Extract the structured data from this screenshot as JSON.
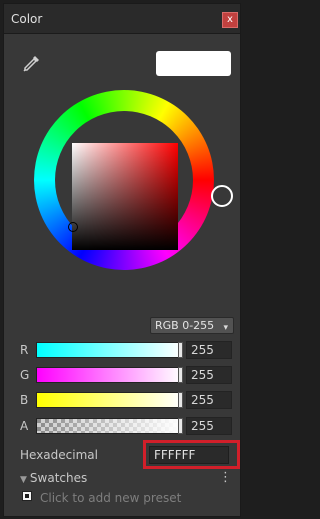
{
  "window": {
    "title": "Color",
    "close_glyph": "x"
  },
  "icons": {
    "eyedropper": "eyedropper-icon",
    "close": "close-icon"
  },
  "current_color": "#ffffff",
  "mode_select": {
    "value": "RGB 0-255",
    "arrow": "▾"
  },
  "channels": [
    {
      "label": "R",
      "value": "255"
    },
    {
      "label": "G",
      "value": "255"
    },
    {
      "label": "B",
      "value": "255"
    },
    {
      "label": "A",
      "value": "255"
    }
  ],
  "hex": {
    "label": "Hexadecimal",
    "value": "FFFFFF"
  },
  "swatches": {
    "label": "Swatches",
    "expander": "▼",
    "menu": "⋮",
    "add_preset_hint": "Click to add new preset"
  },
  "colors": {
    "accent_outline": "#d21f2a",
    "close": "#c2413f",
    "panel": "#383838"
  }
}
